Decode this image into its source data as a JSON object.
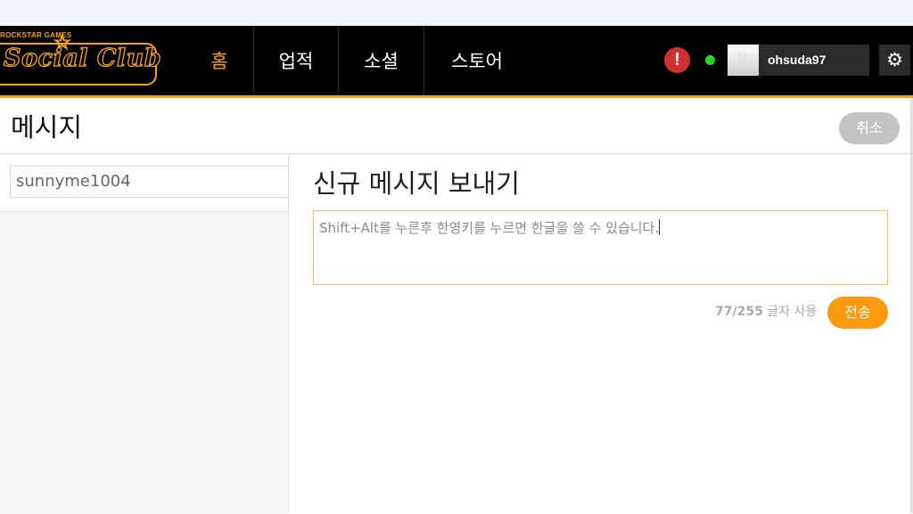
{
  "logo": {
    "top_text": "ROCKSTAR GAMES",
    "script_text": "Social Club",
    "icon": "star-icon"
  },
  "nav": {
    "items": [
      {
        "label": "홈",
        "active": true
      },
      {
        "label": "업적",
        "active": false
      },
      {
        "label": "소셜",
        "active": false
      },
      {
        "label": "스토어",
        "active": false
      }
    ]
  },
  "header": {
    "alert_icon": "alert-icon",
    "alert_symbol": "!",
    "online_status_color": "#26d626",
    "avatar_letter": "R",
    "username": "ohsuda97",
    "settings_icon": "gear-icon",
    "settings_symbol": "⚙"
  },
  "page": {
    "title": "메시지",
    "cancel_label": "취소"
  },
  "sidebar": {
    "recipient": "sunnyme1004"
  },
  "compose": {
    "title": "신규 메시지 보내기",
    "message": "Shift+Alt를 누른후 한영키를 누르면 한글을 쓸 수 있습니다.",
    "char_used": "77/255",
    "char_suffix": "글자 사용",
    "send_label": "전송"
  },
  "colors": {
    "accent": "#f7a21b",
    "send_button": "#fb9a0f",
    "cancel_button": "#c4c4c4",
    "alert": "#d32f2f"
  }
}
